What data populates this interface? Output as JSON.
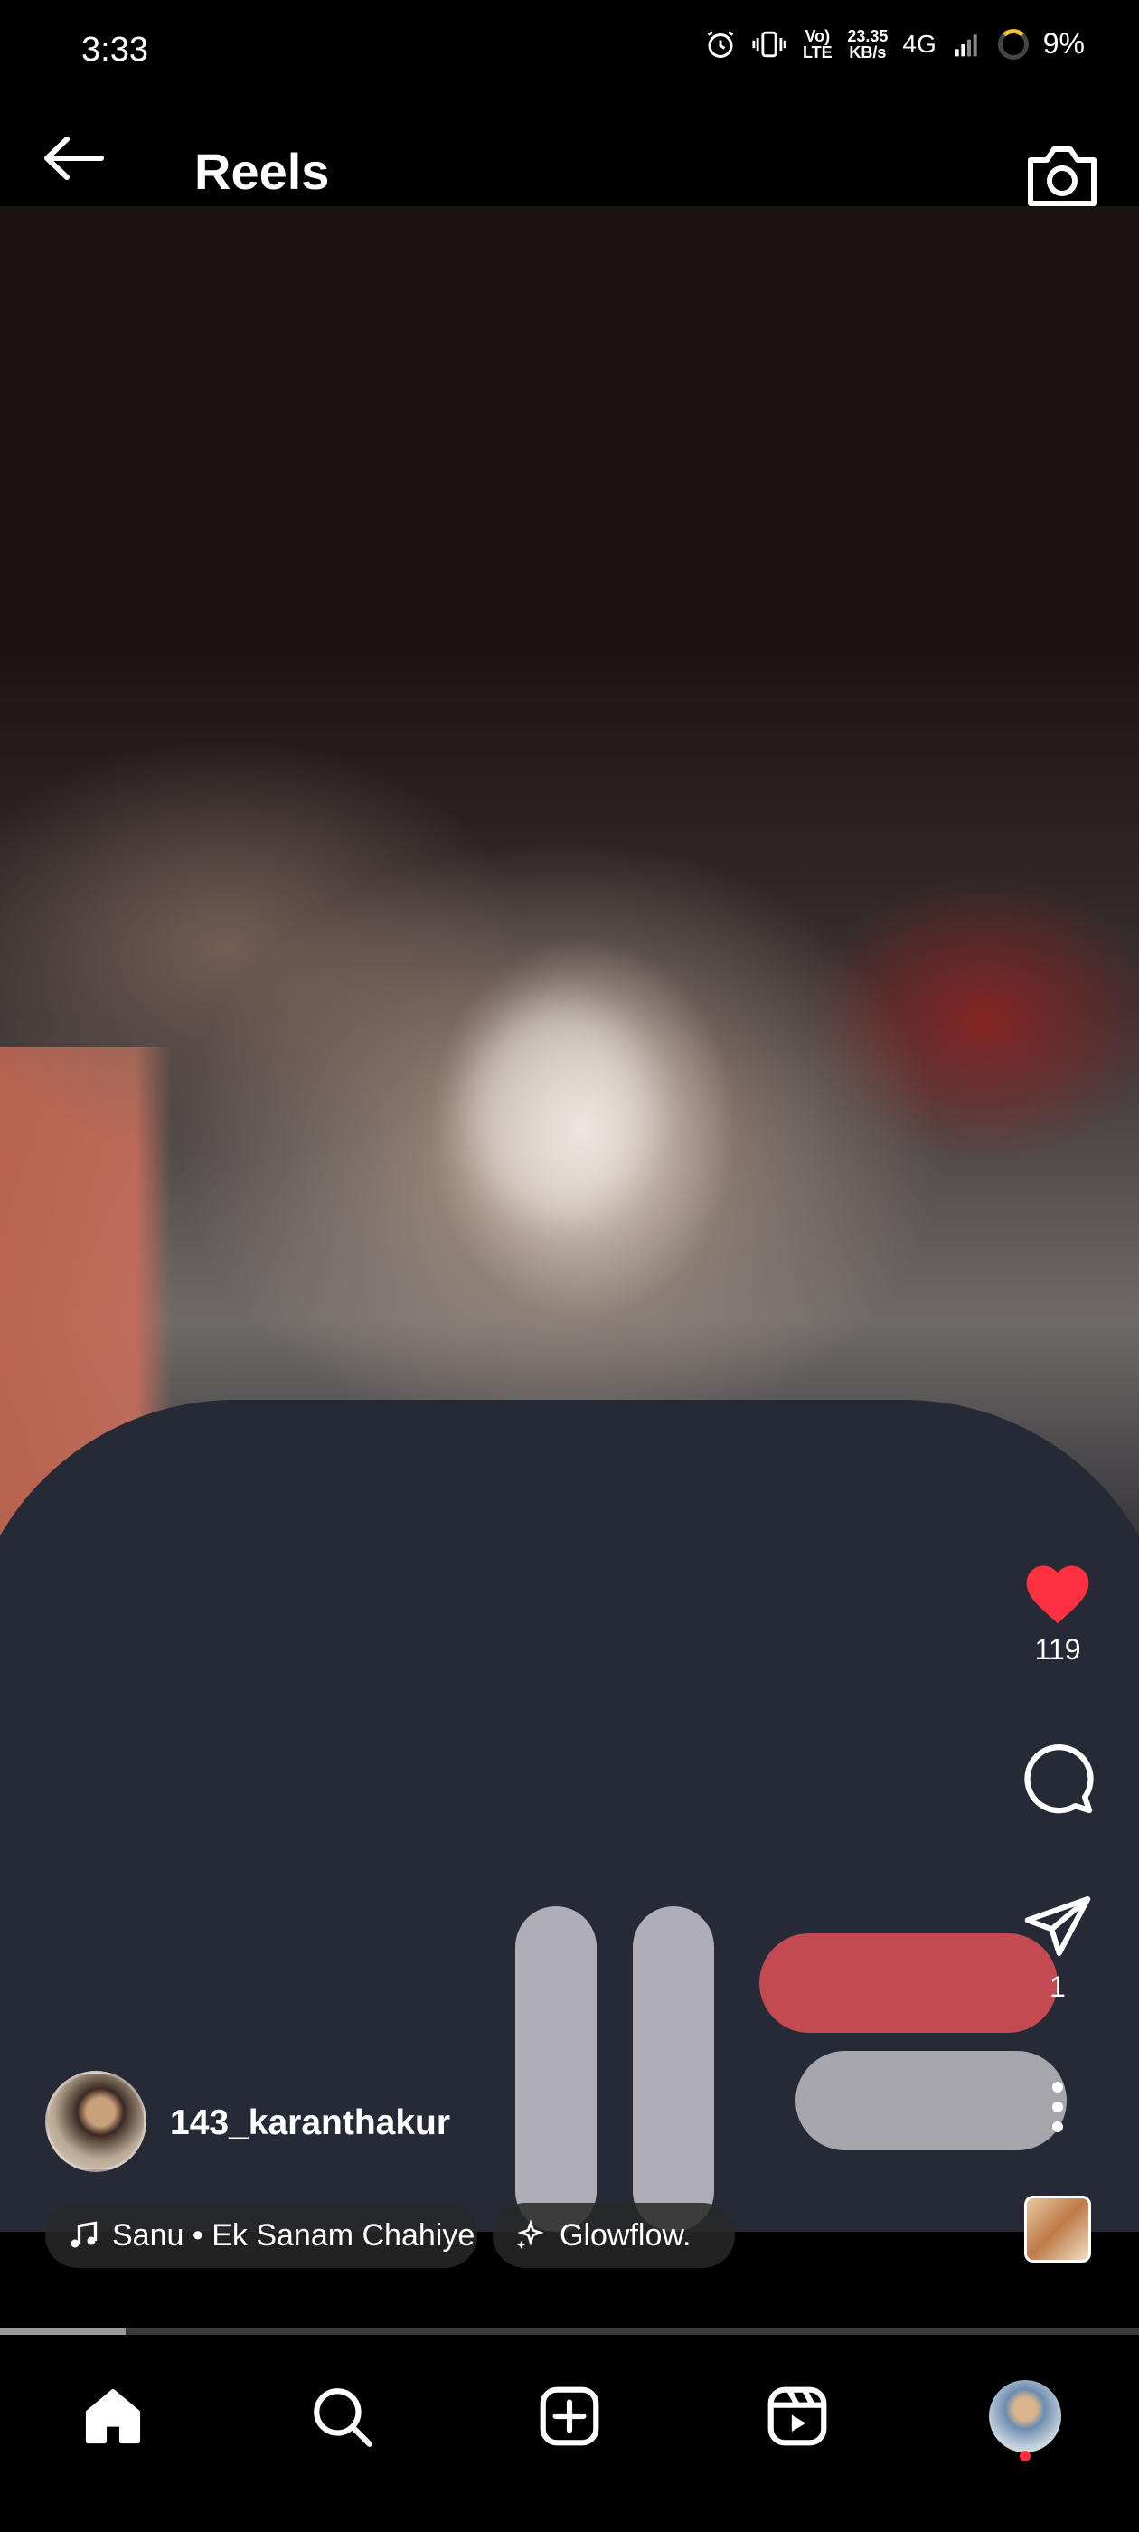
{
  "status_bar": {
    "time": "3:33",
    "volte": "Vo) LTE",
    "speed_value": "23.35",
    "speed_unit": "KB/s",
    "network": "4G",
    "battery": "9%"
  },
  "header": {
    "title": "Reels"
  },
  "reel": {
    "likes": "119",
    "shares": "1",
    "username": "143_karanthakur",
    "audio": "Sanu • Ek Sanam Chahiye",
    "effect": "Glowflow.",
    "progress": 0.11,
    "like_color": "#ff3040"
  },
  "nav": {
    "items": [
      "home-icon",
      "search-icon",
      "create-icon",
      "reels-icon",
      "profile-avatar"
    ]
  }
}
